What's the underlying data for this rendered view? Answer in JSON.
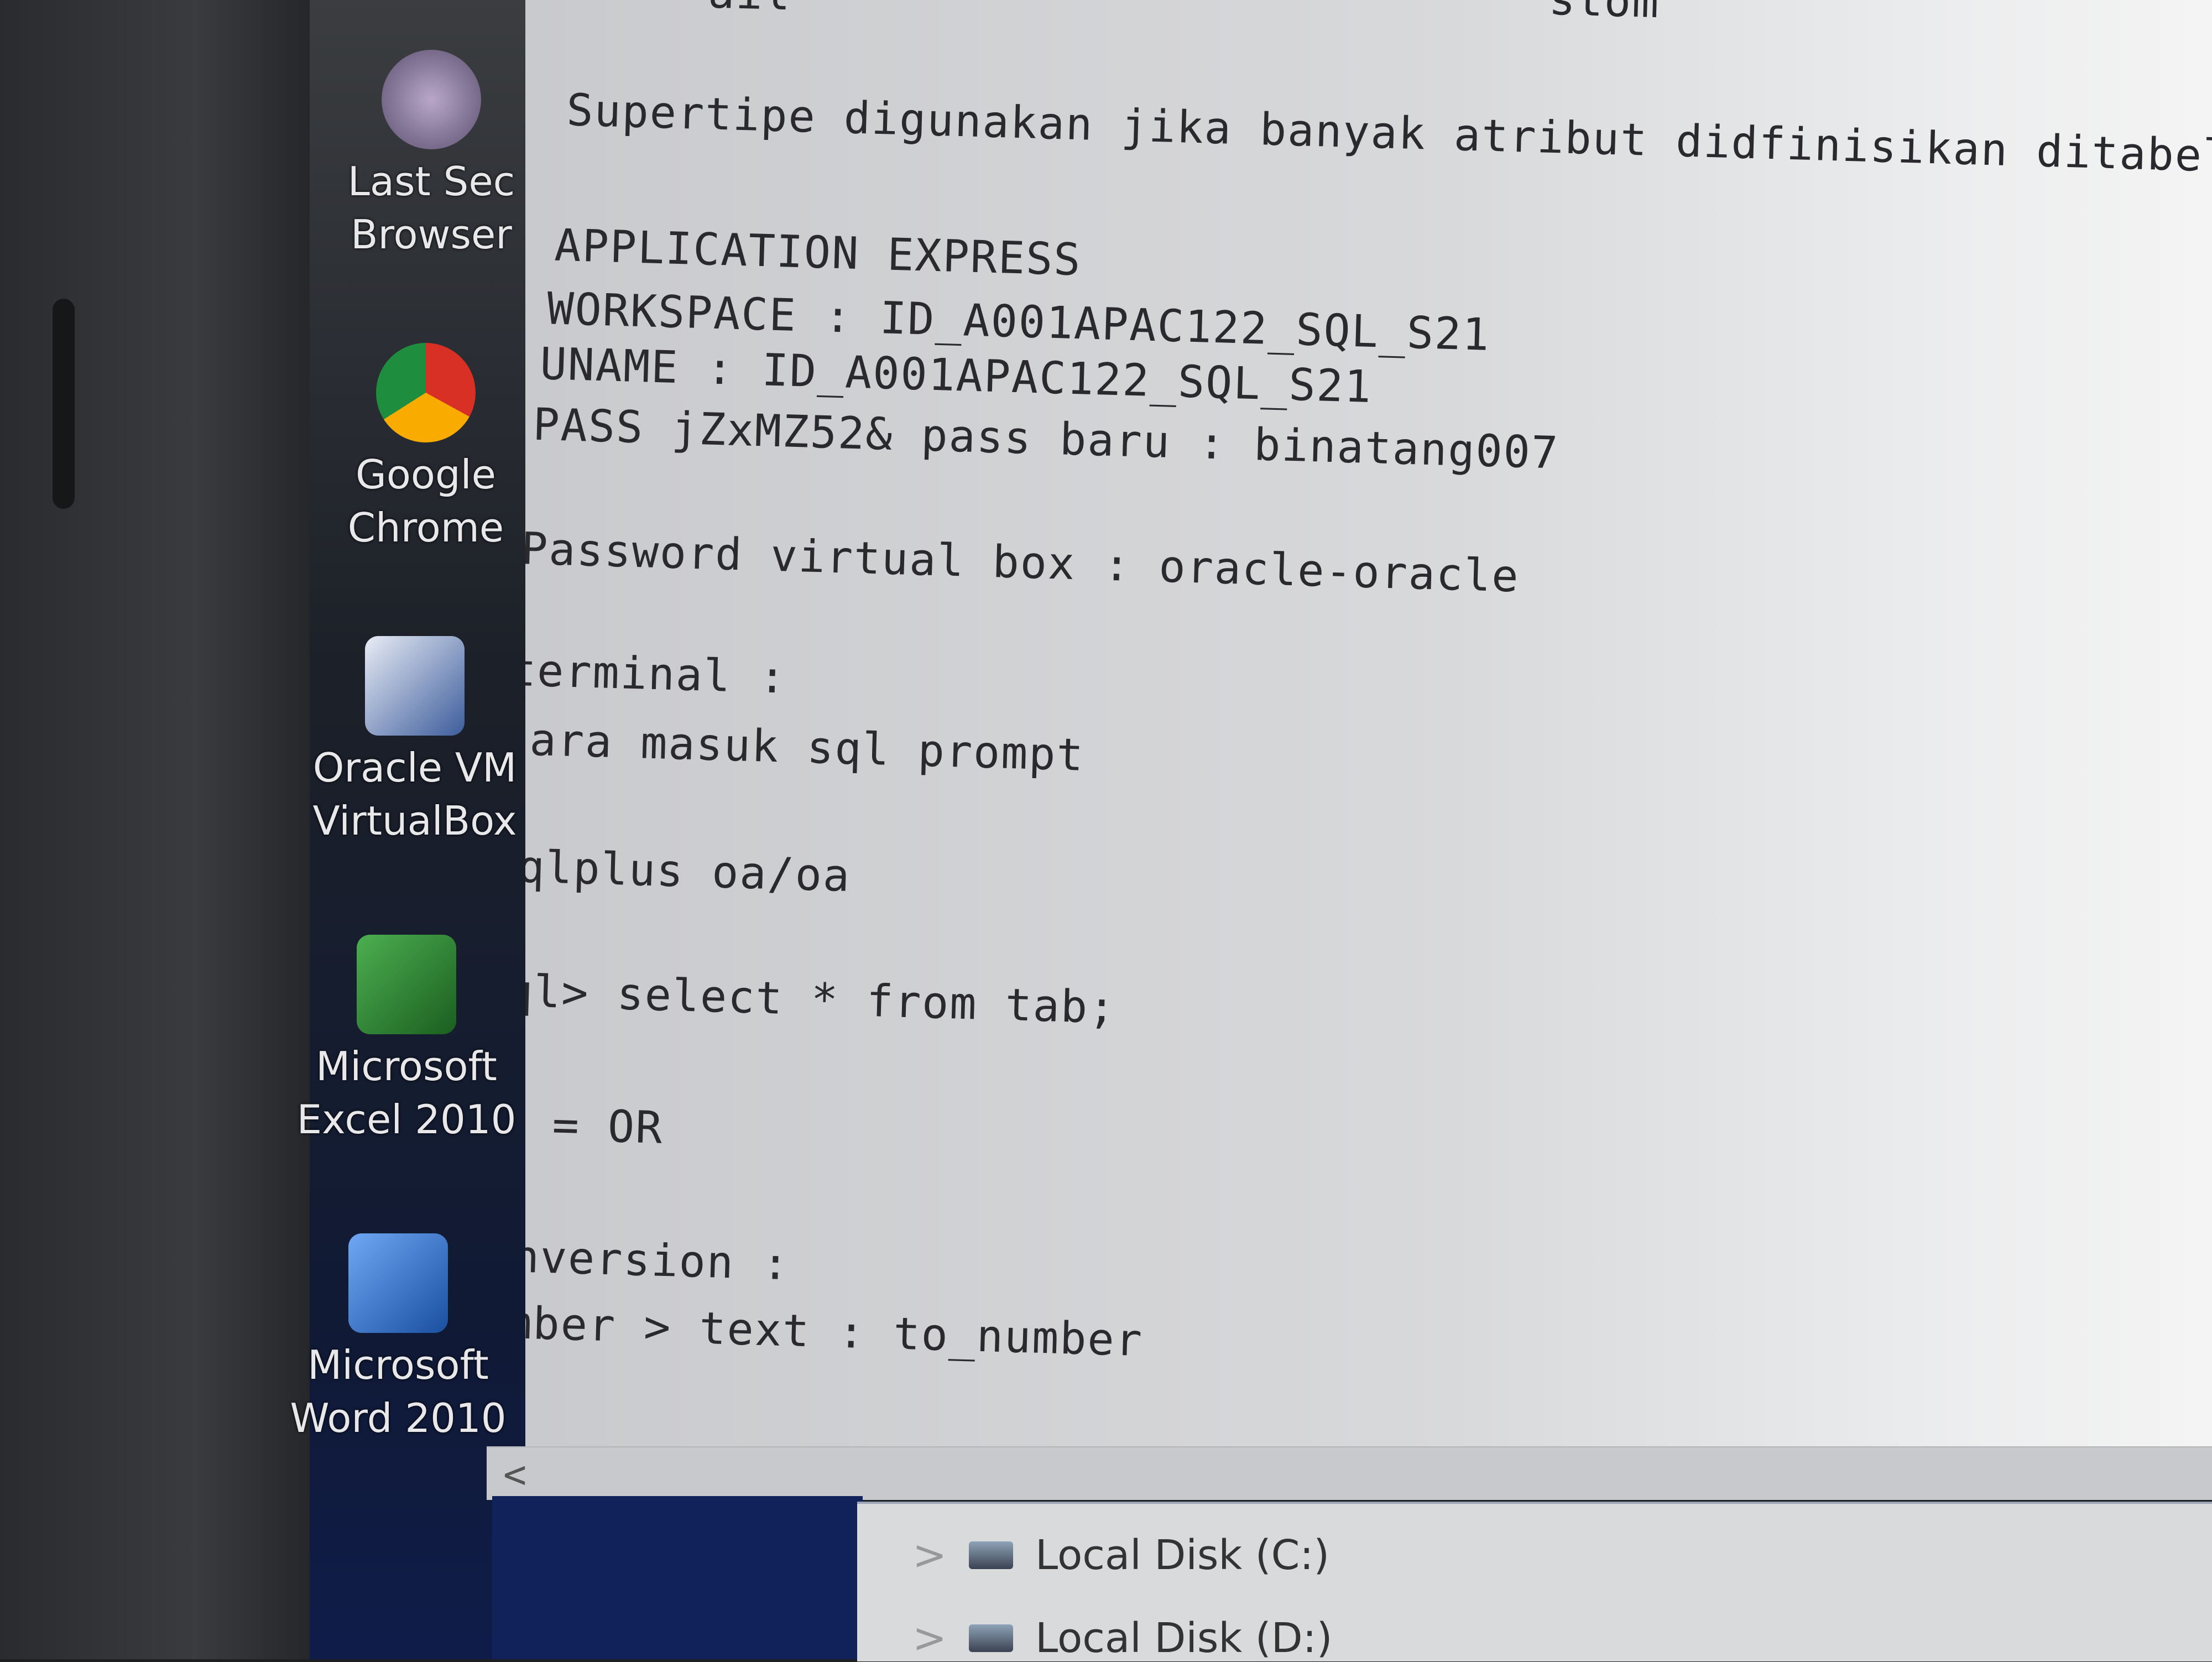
{
  "desktop": {
    "icons": [
      {
        "label_1": "Last Sec",
        "label_2": "Browser",
        "icon": "browser-icon",
        "color": "#7a6f8f"
      },
      {
        "label_1": "Google",
        "label_2": "Chrome",
        "icon": "chrome-icon",
        "color": "#3a7bd5"
      },
      {
        "label_1": "Oracle VM",
        "label_2": "VirtualBox",
        "icon": "virtualbox-icon",
        "color": "#3d5d9c"
      },
      {
        "label_1": "Microsoft",
        "label_2": "Excel 2010",
        "icon": "excel-icon",
        "color": "#2e8b57"
      },
      {
        "label_1": "Microsoft",
        "label_2": "Word 2010",
        "icon": "word-icon",
        "color": "#2b5fb8"
      }
    ]
  },
  "editor": {
    "top_fragments": [
      "ail",
      "stom"
    ],
    "lines": [
      "Supertipe digunakan jika banyak atribut didfinisikan ditabel",
      "APPLICATION EXPRESS",
      "WORKSPACE : ID_A001APAC122_SQL_S21",
      "UNAME : ID_A001APAC122_SQL_S21",
      "PASS jZxMZ52& pass baru : binatang007",
      "Password virtual box : oracle-oracle",
      "terminal :",
      "cara masuk sql prompt",
      "sqlplus oa/oa",
      "sql> select * from tab;",
      "IN = OR",
      "Conversion :",
      "number > text : to_number"
    ],
    "scroll_left": "<"
  },
  "explorer": {
    "items": [
      {
        "expander": ">",
        "label": "Local Disk (C:)"
      },
      {
        "expander": ">",
        "label": "Local Disk (D:)"
      }
    ]
  }
}
